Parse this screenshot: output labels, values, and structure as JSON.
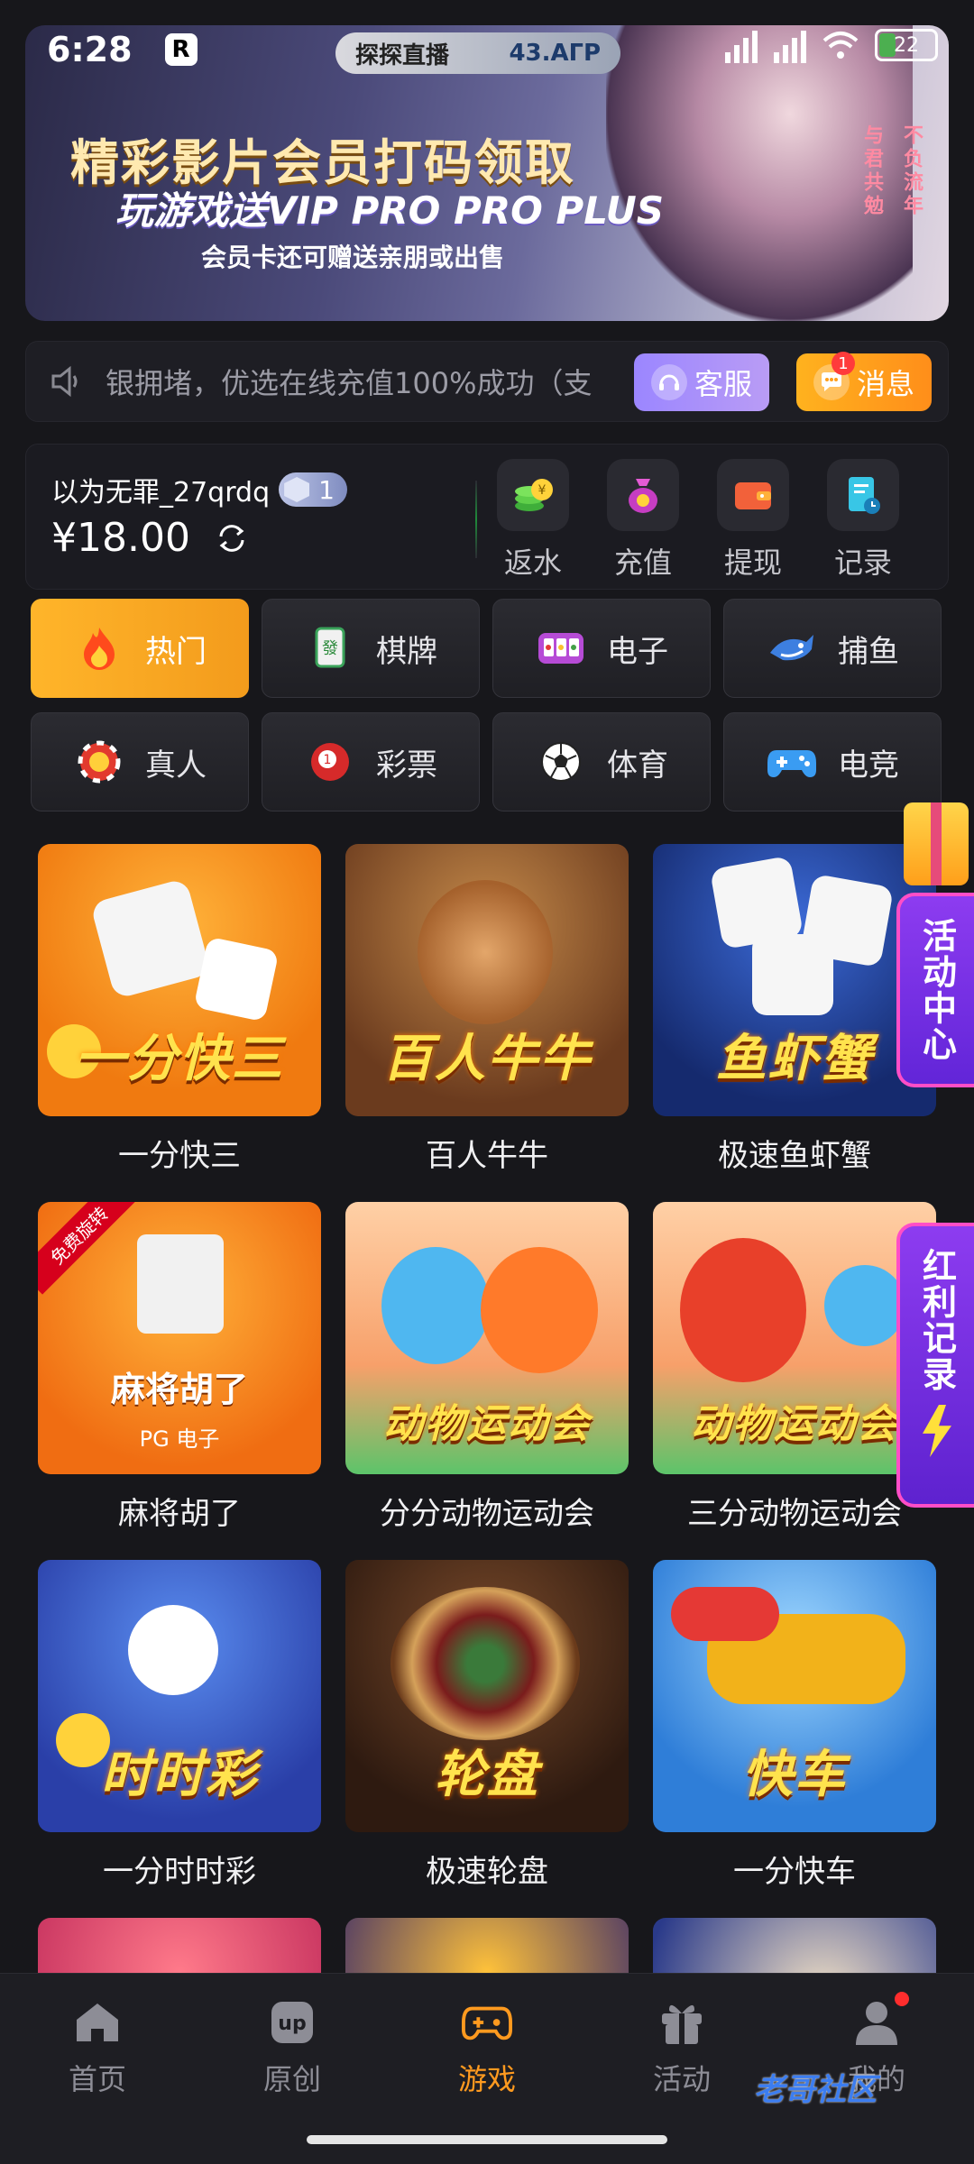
{
  "status": {
    "time": "6:28",
    "app_badge": "R",
    "live_label": "探探直播",
    "live_code": "43.AᒥP",
    "battery": "22"
  },
  "banner": {
    "title": "精彩影片会员打码领取",
    "subtitle": "玩游戏送VIP PRO PRO PLUS",
    "small": "会员卡还可赠送亲朋或出售",
    "vertical_left": "与君共勉",
    "vertical_right": "不负流年"
  },
  "notice": {
    "text": "银拥堵，优选在线充值100%成功（支",
    "service_label": "客服",
    "message_label": "消息",
    "message_badge": "1"
  },
  "account": {
    "username": "以为无罪_27qrdq",
    "vip_level": "1",
    "balance": "¥18.00",
    "actions": [
      "返水",
      "充值",
      "提现",
      "记录"
    ]
  },
  "categories": [
    "热门",
    "棋牌",
    "电子",
    "捕鱼",
    "真人",
    "彩票",
    "体育",
    "电竞"
  ],
  "games": [
    {
      "name": "一分快三",
      "thumb_text": "一分快三"
    },
    {
      "name": "百人牛牛",
      "thumb_text": "百人牛牛"
    },
    {
      "name": "极速鱼虾蟹",
      "thumb_text": "鱼虾蟹"
    },
    {
      "name": "麻将胡了",
      "thumb_text": "麻将胡了",
      "thumb_sub": "PG 电子",
      "tag": "免费旋转"
    },
    {
      "name": "分分动物运动会",
      "thumb_text": "动物运动会"
    },
    {
      "name": "三分动物运动会",
      "thumb_text": "动物运动会"
    },
    {
      "name": "一分时时彩",
      "thumb_text": "时时彩"
    },
    {
      "name": "极速轮盘",
      "thumb_text": "轮盘"
    },
    {
      "name": "一分快车",
      "thumb_text": "快车"
    }
  ],
  "side": {
    "activity": "活动中心",
    "bonus": "红利记录"
  },
  "nav": [
    "首页",
    "原创",
    "游戏",
    "活动",
    "我的"
  ],
  "watermark": "老哥社区",
  "colors": {
    "accent": "#ff9a1f",
    "service": "#a78dfb",
    "message": "#ff9f1c",
    "side_widget": "#7a30e6"
  }
}
